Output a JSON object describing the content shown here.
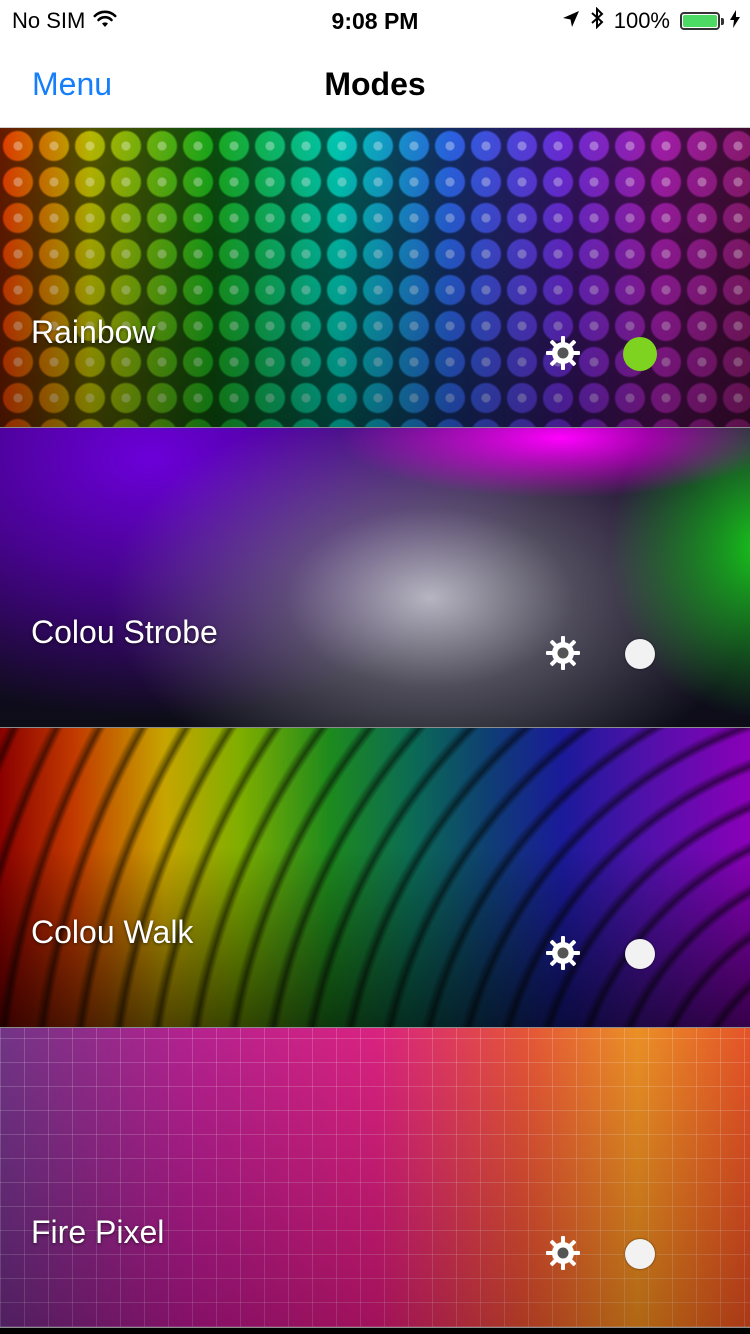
{
  "status_bar": {
    "carrier": "No SIM",
    "time": "9:08 PM",
    "battery": "100%",
    "icons": [
      "wifi-icon",
      "location-arrow-icon",
      "bluetooth-icon",
      "battery-icon",
      "charging-icon"
    ]
  },
  "nav": {
    "back_label": "Menu",
    "title": "Modes"
  },
  "modes": [
    {
      "label": "Rainbow",
      "selected": true
    },
    {
      "label": "Colou Strobe",
      "selected": false
    },
    {
      "label": "Colou Walk",
      "selected": false
    },
    {
      "label": "Fire Pixel",
      "selected": false
    }
  ],
  "colors": {
    "accent": "#157efb",
    "selected_indicator": "#7ed321",
    "battery_fill": "#4cd964"
  }
}
